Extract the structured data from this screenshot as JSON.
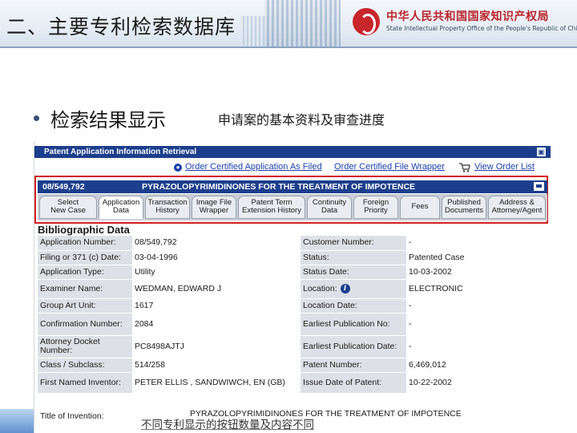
{
  "slide": {
    "title": "二、主要专利检索数据库",
    "org_cn": "中华人民共和国国家知识产权局",
    "org_en": "State Intellectual Property Office of the People's Republic of China",
    "bullet": "检索结果显示",
    "caption_top": "申请案的基本资料及审查进度",
    "caption_bottom": "不同专利显示的按钮数量及内容不同"
  },
  "pair": {
    "window_title": "Patent Application Information Retrieval",
    "order_file_as_filed": "Order Certified Application As Filed",
    "order_file_wrapper": "Order Certified File Wrapper",
    "view_order_list": "View Order List",
    "application_number_bar": "08/549,792",
    "application_title_bar": "PYRAZOLOPYRIMIDINONES FOR THE TREATMENT OF IMPOTENCE",
    "tabs": [
      {
        "label": "Select\nNew Case"
      },
      {
        "label": "Application\nData"
      },
      {
        "label": "Transaction\nHistory"
      },
      {
        "label": "Image File\nWrapper"
      },
      {
        "label": "Patent Term\nExtension History"
      },
      {
        "label": "Continuity\nData"
      },
      {
        "label": "Foreign\nPriority"
      },
      {
        "label": "Fees"
      },
      {
        "label": "Published\nDocuments"
      },
      {
        "label": "Address &\nAttorney/Agent"
      }
    ],
    "section_heading": "Bibliographic Data",
    "rows": [
      {
        "l1": "Application Number:",
        "v1": "08/549,792",
        "l2": "Customer Number:",
        "v2": "-"
      },
      {
        "l1": "Filing or 371 (c) Date:",
        "v1": "03-04-1996",
        "l2": "Status:",
        "v2": "Patented Case"
      },
      {
        "l1": "Application Type:",
        "v1": "Utility",
        "l2": "Status Date:",
        "v2": "10-03-2002"
      },
      {
        "l1": "Examiner Name:",
        "v1": "WEDMAN, EDWARD J",
        "l2": "Location:",
        "v2": "ELECTRONIC"
      },
      {
        "l1": "Group Art Unit:",
        "v1": "1617",
        "l2": "Location Date:",
        "v2": "-"
      },
      {
        "l1": "Confirmation Number:",
        "v1": "2084",
        "l2": "Earliest Publication No:",
        "v2": "-"
      },
      {
        "l1": "Attorney Docket Number:",
        "v1": "PC8498AJTJ",
        "l2": "Earliest Publication Date:",
        "v2": "-"
      },
      {
        "l1": "Class / Subclass:",
        "v1": "514/258",
        "l2": "Patent Number:",
        "v2": "6,469,012"
      },
      {
        "l1": "First Named Inventor:",
        "v1": "PETER ELLIS , SANDWIWCH, EN (GB)",
        "l2": "Issue Date of Patent:",
        "v2": "10-22-2002"
      }
    ],
    "title_label": "Title of Invention:",
    "title_value": "PYRAZOLOPYRIMIDINONES FOR THE TREATMENT OF IMPOTENCE"
  }
}
